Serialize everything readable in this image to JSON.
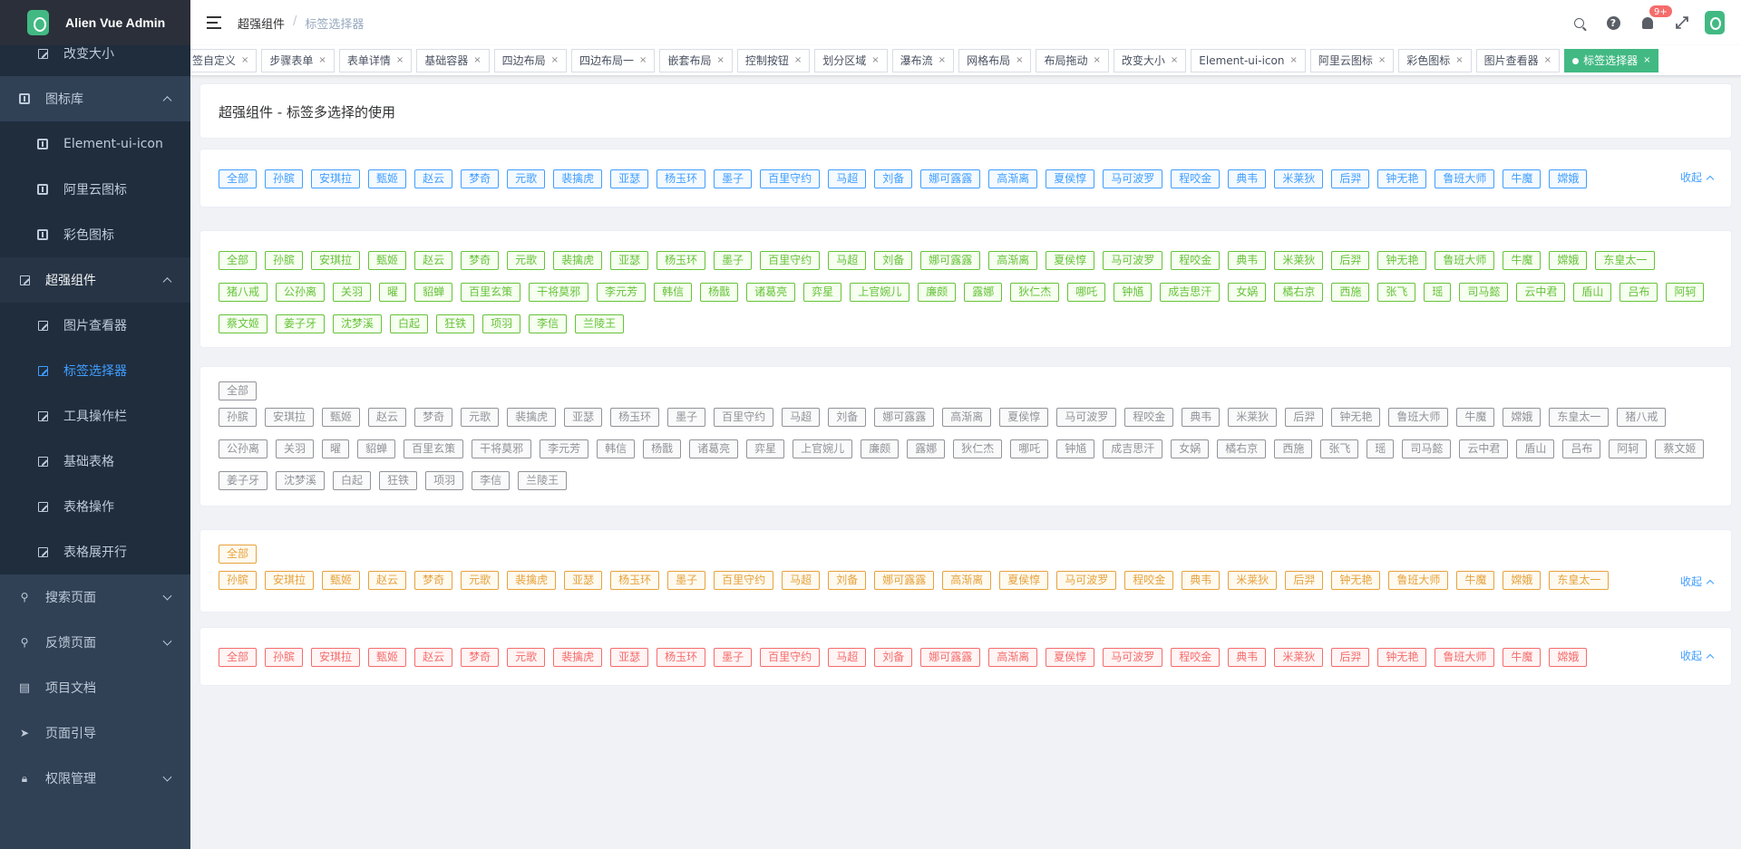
{
  "app": {
    "title": "Alien Vue Admin"
  },
  "sidebar": {
    "items": [
      {
        "label": "改变大小",
        "kind": "sub",
        "icon": "edit-icon",
        "name": "sidebar-item-resize"
      },
      {
        "label": "图标库",
        "kind": "parent-open",
        "icon": "box-icon",
        "name": "sidebar-item-icon-library"
      },
      {
        "label": "Element-ui-icon",
        "kind": "sub",
        "icon": "box-icon",
        "name": "sidebar-item-element-ui-icon"
      },
      {
        "label": "阿里云图标",
        "kind": "sub",
        "icon": "box-icon",
        "name": "sidebar-item-aliyun-icon"
      },
      {
        "label": "彩色图标",
        "kind": "sub",
        "icon": "box-icon",
        "name": "sidebar-item-color-icon"
      },
      {
        "label": "超强组件",
        "kind": "parent-open",
        "icon": "edit-icon",
        "name": "sidebar-item-super-components"
      },
      {
        "label": "图片查看器",
        "kind": "sub",
        "icon": "edit-icon",
        "name": "sidebar-item-image-viewer"
      },
      {
        "label": "标签选择器",
        "kind": "sub-active",
        "icon": "edit-icon",
        "name": "sidebar-item-tag-selector"
      },
      {
        "label": "工具操作栏",
        "kind": "sub",
        "icon": "edit-icon",
        "name": "sidebar-item-toolbar"
      },
      {
        "label": "基础表格",
        "kind": "sub",
        "icon": "edit-icon",
        "name": "sidebar-item-basic-table"
      },
      {
        "label": "表格操作",
        "kind": "sub",
        "icon": "edit-icon",
        "name": "sidebar-item-table-ops"
      },
      {
        "label": "表格展开行",
        "kind": "sub",
        "icon": "edit-icon",
        "name": "sidebar-item-table-expand"
      },
      {
        "label": "搜索页面",
        "kind": "parent-closed",
        "icon": "search-icon",
        "name": "sidebar-item-search-page"
      },
      {
        "label": "反馈页面",
        "kind": "parent-closed",
        "icon": "search-icon",
        "name": "sidebar-item-feedback-page"
      },
      {
        "label": "项目文档",
        "kind": "top",
        "icon": "document-icon",
        "name": "sidebar-item-docs"
      },
      {
        "label": "页面引导",
        "kind": "top",
        "icon": "send-icon",
        "name": "sidebar-item-guide"
      },
      {
        "label": "权限管理",
        "kind": "parent-closed",
        "icon": "lock-icon",
        "name": "sidebar-item-permission"
      }
    ]
  },
  "breadcrumb": {
    "level1": "超强组件",
    "separator": "/",
    "level2": "标签选择器"
  },
  "navbar": {
    "badge": "9+",
    "help": "?"
  },
  "tagsview": {
    "tabs": [
      "签自定义",
      "步骤表单",
      "表单详情",
      "基础容器",
      "四边布局",
      "四边布局一",
      "嵌套布局",
      "控制按钮",
      "划分区域",
      "瀑布流",
      "网格布局",
      "布局拖动",
      "改变大小",
      "Element-ui-icon",
      "阿里云图标",
      "彩色图标",
      "图片查看器",
      "标签选择器"
    ],
    "active_index": 17
  },
  "page": {
    "header": "超强组件 - 标签多选择的使用",
    "collapse_label": "收起"
  },
  "colors": {
    "blue": "#409eff",
    "green": "#67c23a",
    "gray": "#909399",
    "orange": "#e6a23c",
    "red": "#f56c6c"
  },
  "tag_sets": {
    "short": [
      "全部",
      "孙膑",
      "安琪拉",
      "甄姬",
      "赵云",
      "梦奇",
      "元歌",
      "裴擒虎",
      "亚瑟",
      "杨玉环",
      "墨子",
      "百里守约",
      "马超",
      "刘备",
      "娜可露露",
      "高渐离",
      "夏侯惇",
      "马可波罗",
      "程咬金",
      "典韦",
      "米莱狄",
      "后羿",
      "钟无艳",
      "鲁班大师",
      "牛魔",
      "嫦娥"
    ],
    "full": [
      "全部",
      "孙膑",
      "安琪拉",
      "甄姬",
      "赵云",
      "梦奇",
      "元歌",
      "裴擒虎",
      "亚瑟",
      "杨玉环",
      "墨子",
      "百里守约",
      "马超",
      "刘备",
      "娜可露露",
      "高渐离",
      "夏侯惇",
      "马可波罗",
      "程咬金",
      "典韦",
      "米莱狄",
      "后羿",
      "钟无艳",
      "鲁班大师",
      "牛魔",
      "嫦娥",
      "东皇太一",
      "猪八戒",
      "公孙离",
      "关羽",
      "曜",
      "貂蝉",
      "百里玄策",
      "干将莫邪",
      "李元芳",
      "韩信",
      "杨戬",
      "诸葛亮",
      "弈星",
      "上官婉儿",
      "廉颇",
      "露娜",
      "狄仁杰",
      "哪吒",
      "钟馗",
      "成吉思汗",
      "女娲",
      "橘右京",
      "西施",
      "张飞",
      "瑶",
      "司马懿",
      "云中君",
      "盾山",
      "吕布",
      "阿轲",
      "蔡文姬",
      "姜子牙",
      "沈梦溪",
      "白起",
      "狂铁",
      "项羽",
      "李信",
      "兰陵王"
    ],
    "orange": [
      "全部",
      "孙膑",
      "安琪拉",
      "甄姬",
      "赵云",
      "梦奇",
      "元歌",
      "裴擒虎",
      "亚瑟",
      "杨玉环",
      "墨子",
      "百里守约",
      "马超",
      "刘备",
      "娜可露露",
      "高渐离",
      "夏侯惇",
      "马可波罗",
      "程咬金",
      "典韦",
      "米莱狄",
      "后羿",
      "钟无艳",
      "鲁班大师",
      "牛魔",
      "嫦娥",
      "东皇太一"
    ]
  }
}
